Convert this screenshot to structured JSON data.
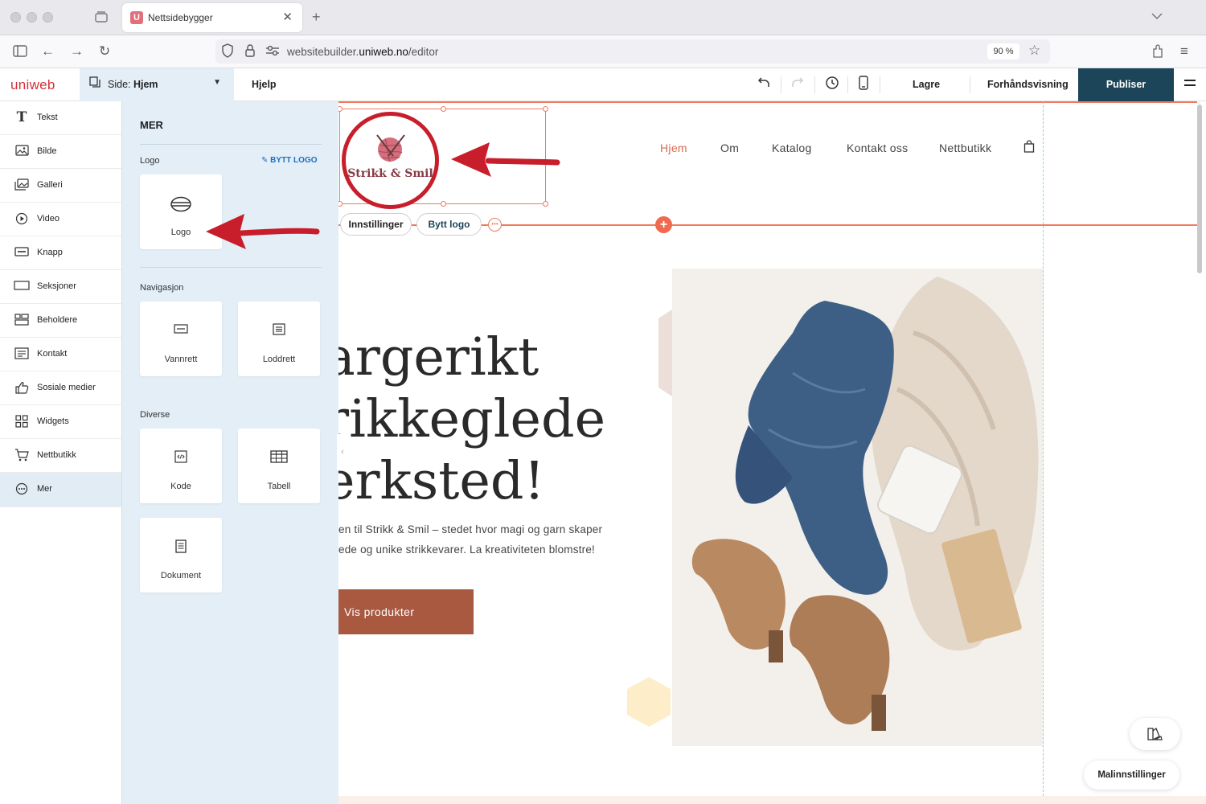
{
  "browser": {
    "tab_title": "Nettsidebygger",
    "tab_favicon": "U",
    "url_prefix": "websitebuilder.",
    "url_domain": "uniweb.no",
    "url_path": "/editor",
    "zoom": "90 %"
  },
  "toolbar": {
    "brand": "uniweb",
    "page_label": "Side:",
    "page_name": "Hjem",
    "help": "Hjelp",
    "save": "Lagre",
    "preview": "Forhåndsvisning",
    "publish": "Publiser"
  },
  "sidebar": {
    "items": [
      {
        "label": "Tekst",
        "icon": "text-icon"
      },
      {
        "label": "Bilde",
        "icon": "image-icon"
      },
      {
        "label": "Galleri",
        "icon": "gallery-icon"
      },
      {
        "label": "Video",
        "icon": "video-icon"
      },
      {
        "label": "Knapp",
        "icon": "button-icon"
      },
      {
        "label": "Seksjoner",
        "icon": "section-icon"
      },
      {
        "label": "Beholdere",
        "icon": "container-icon"
      },
      {
        "label": "Kontakt",
        "icon": "contact-icon"
      },
      {
        "label": "Sosiale medier",
        "icon": "thumbs-up-icon"
      },
      {
        "label": "Widgets",
        "icon": "widgets-icon"
      },
      {
        "label": "Nettbutikk",
        "icon": "cart-icon"
      },
      {
        "label": "Mer",
        "icon": "more-icon"
      }
    ]
  },
  "panel": {
    "title": "MER",
    "logo_section": "Logo",
    "swap_logo": "BYTT LOGO",
    "logo_card": "Logo",
    "nav_section": "Navigasjon",
    "nav_horizontal": "Vannrett",
    "nav_vertical": "Loddrett",
    "misc_section": "Diverse",
    "code": "Kode",
    "table": "Tabell",
    "document": "Dokument"
  },
  "canvas": {
    "logo_text": "Strikk & Smil",
    "settings_pill": "Innstillinger",
    "swap_logo_pill": "Bytt logo",
    "menu": [
      "Hjem",
      "Om",
      "Katalog",
      "Kontakt oss",
      "Nettbutikk"
    ],
    "headline": [
      "argerikt",
      "rikkeglede",
      "erksted!"
    ],
    "intro": [
      "en til Strikk & Smil – stedet hvor magi og garn skaper",
      "ede og unike strikkevarer. La kreativiteten blomstre!"
    ],
    "cta": "Vis produkter",
    "template_settings": "Malinnstillinger"
  },
  "colors": {
    "accent": "#f07a5f",
    "publish_bg": "#1d4559",
    "brand_red": "#d2323c",
    "cta_bg": "#a85940",
    "annotation_red": "#c81e2b"
  }
}
